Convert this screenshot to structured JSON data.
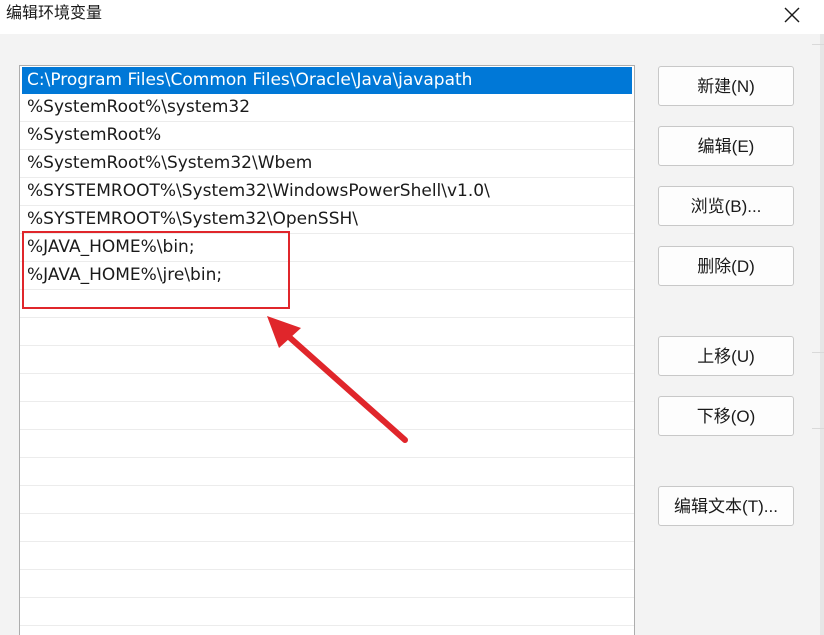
{
  "window": {
    "title": "编辑环境变量"
  },
  "list": {
    "items": [
      "C:\\Program Files\\Common Files\\Oracle\\Java\\javapath",
      "%SystemRoot%\\system32",
      "%SystemRoot%",
      "%SystemRoot%\\System32\\Wbem",
      "%SYSTEMROOT%\\System32\\WindowsPowerShell\\v1.0\\",
      "%SYSTEMROOT%\\System32\\OpenSSH\\",
      "%JAVA_HOME%\\bin;",
      "%JAVA_HOME%\\jre\\bin;"
    ],
    "selected_index": 0
  },
  "buttons": {
    "new": "新建(N)",
    "edit": "编辑(E)",
    "browse": "浏览(B)...",
    "delete": "删除(D)",
    "move_up": "上移(U)",
    "move_down": "下移(O)",
    "edit_text": "编辑文本(T)..."
  },
  "colors": {
    "selection": "#0078d7",
    "annotation": "#e0262b"
  }
}
